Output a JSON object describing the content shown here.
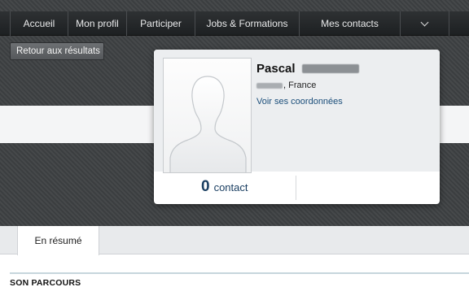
{
  "nav": {
    "items": [
      {
        "label": "Accueil"
      },
      {
        "label": "Mon profil"
      },
      {
        "label": "Participer"
      },
      {
        "label": "Jobs & Formations"
      },
      {
        "label": "Mes contacts"
      }
    ],
    "more_icon": "chevron-down-icon"
  },
  "back_button": {
    "label": "Retour aux résultats"
  },
  "profile": {
    "first_name": "Pascal",
    "location": ", France",
    "coords_link": "Voir ses coordonnées",
    "avatar_icon": "person-silhouette-icon"
  },
  "contacts": {
    "count": "0",
    "label": "contact"
  },
  "tabs": [
    {
      "label": "En résumé"
    }
  ],
  "section": {
    "title": "SON PARCOURS"
  },
  "colors": {
    "dark_band": "#3f4244",
    "link": "#1b4e7a",
    "count": "#1b3f62"
  }
}
